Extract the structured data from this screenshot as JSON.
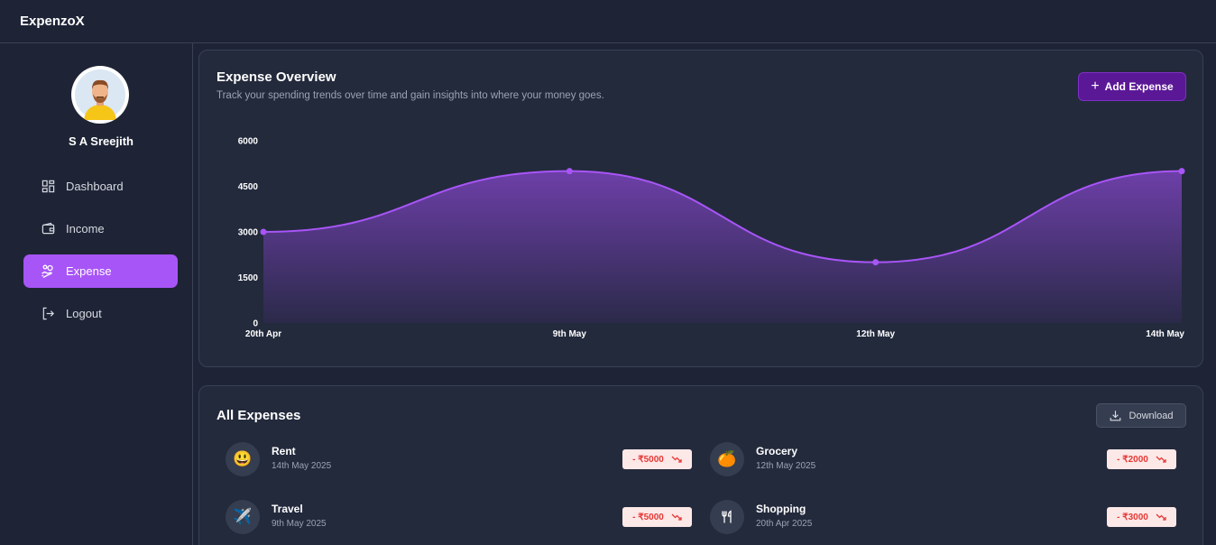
{
  "app": {
    "title": "ExpenzoX"
  },
  "profile": {
    "name": "S A Sreejith",
    "avatar_icon": "user-avatar-icon"
  },
  "sidebar": {
    "items": [
      {
        "label": "Dashboard",
        "icon": "dashboard-icon",
        "active": false
      },
      {
        "label": "Income",
        "icon": "wallet-icon",
        "active": false
      },
      {
        "label": "Expense",
        "icon": "hand-coins-icon",
        "active": true
      },
      {
        "label": "Logout",
        "icon": "logout-icon",
        "active": false
      }
    ]
  },
  "overview": {
    "title": "Expense Overview",
    "subtitle": "Track your spending trends over time and gain insights into where your money goes.",
    "add_button_label": "Add Expense"
  },
  "chart_data": {
    "type": "area",
    "categories": [
      "20th Apr",
      "9th May",
      "12th May",
      "14th May"
    ],
    "values": [
      3000,
      5000,
      2000,
      5000
    ],
    "yticks": [
      "0",
      "1500",
      "3000",
      "4500",
      "6000"
    ],
    "ylim": [
      0,
      6000
    ],
    "grid": false,
    "colors": {
      "line": "#a855f7",
      "fill_top": "#6d3fa8",
      "fill_bottom": "#2b2a4a"
    }
  },
  "expenses": {
    "title": "All Expenses",
    "download_label": "Download",
    "items": [
      {
        "name": "Rent",
        "date": "14th May 2025",
        "amount": "- ₹5000",
        "icon": "😃"
      },
      {
        "name": "Grocery",
        "date": "12th May 2025",
        "amount": "- ₹2000",
        "icon": "🍊"
      },
      {
        "name": "Travel",
        "date": "9th May 2025",
        "amount": "- ₹5000",
        "icon": "✈️"
      },
      {
        "name": "Shopping",
        "date": "20th Apr 2025",
        "amount": "- ₹3000",
        "icon": "utensils-icon"
      }
    ]
  },
  "colors": {
    "accent": "#a855f7",
    "background": "#1e2436",
    "card": "#232a3c",
    "negative": "#e53935"
  }
}
